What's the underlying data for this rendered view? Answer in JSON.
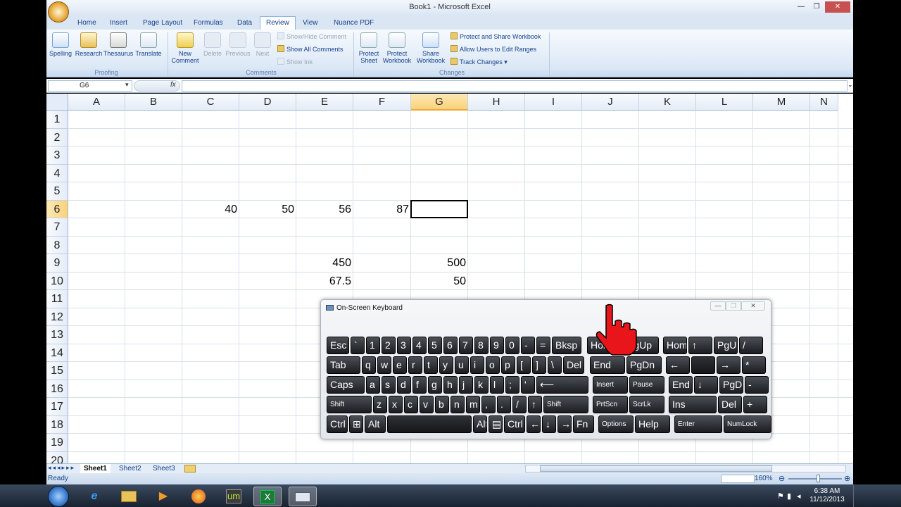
{
  "window": {
    "title": "Book1 - Microsoft Excel",
    "controls": [
      "—",
      "❐",
      "✕"
    ]
  },
  "ribbon": {
    "tabs": [
      "Home",
      "Insert",
      "Page Layout",
      "Formulas",
      "Data",
      "Review",
      "View",
      "Nuance PDF"
    ],
    "active_tab": "Review",
    "proofing": {
      "label": "Proofing",
      "buttons": [
        "Spelling",
        "Research",
        "Thesaurus",
        "Translate"
      ]
    },
    "comments": {
      "label": "Comments",
      "new": "New Comment",
      "delete": "Delete",
      "previous": "Previous",
      "next": "Next",
      "show_hide": "Show/Hide Comment",
      "show_all": "Show All Comments",
      "show_ink": "Show Ink"
    },
    "changes": {
      "label": "Changes",
      "protect_sheet": "Protect Sheet",
      "protect_workbook": "Protect Workbook",
      "share_workbook": "Share Workbook",
      "protect_share": "Protect and Share Workbook",
      "allow_users": "Allow Users to Edit Ranges",
      "track_changes": "Track Changes"
    }
  },
  "formula_bar": {
    "name_box": "G6",
    "fx": "fx",
    "value": ""
  },
  "grid": {
    "columns": [
      "A",
      "B",
      "C",
      "D",
      "E",
      "F",
      "G",
      "H",
      "I",
      "J",
      "K",
      "L",
      "M",
      "N"
    ],
    "selected_column": "G",
    "rows": [
      "1",
      "2",
      "3",
      "4",
      "5",
      "6",
      "7",
      "8",
      "9",
      "10",
      "11",
      "12",
      "13",
      "14",
      "15",
      "16",
      "17",
      "18",
      "19",
      "20"
    ],
    "selected_row": "6",
    "cells": {
      "C6": "40",
      "D6": "50",
      "E6": "56",
      "F6": "87",
      "E9": "450",
      "G9": "500",
      "E10": "67.5",
      "G10": "50"
    }
  },
  "sheets": [
    "Sheet1",
    "Sheet2",
    "Sheet3"
  ],
  "status": {
    "ready": "Ready",
    "zoom": "160%"
  },
  "osk": {
    "title": "On-Screen Keyboard",
    "rows": [
      [
        "Esc",
        "`",
        "1",
        "2",
        "3",
        "4",
        "5",
        "6",
        "7",
        "8",
        "9",
        "0",
        "-",
        "=",
        "Bksp",
        "Home",
        "PgUp",
        "Home",
        "↑",
        "PgUp",
        "/"
      ],
      [
        "Tab",
        "q",
        "w",
        "e",
        "r",
        "t",
        "y",
        "u",
        "i",
        "o",
        "p",
        "[",
        "]",
        "\\",
        "Del",
        "End",
        "PgDn",
        "←",
        "",
        "→",
        "*"
      ],
      [
        "Caps",
        "a",
        "s",
        "d",
        "f",
        "g",
        "h",
        "j",
        "k",
        "l",
        ";",
        "'",
        "⟵",
        "Insert",
        "Pause",
        "End",
        "↓",
        "PgDn",
        "-"
      ],
      [
        "Shift",
        "z",
        "x",
        "c",
        "v",
        "b",
        "n",
        "m",
        ",",
        ".",
        "/",
        "↑",
        "Shift",
        "PrtScn",
        "ScrLk",
        "Ins",
        "Del",
        "+"
      ],
      [
        "Ctrl",
        "⊞",
        "Alt",
        "",
        "Alt",
        "▤",
        "Ctrl",
        "←",
        "↓",
        "→",
        "Fn",
        "Options",
        "Help",
        "Enter",
        "NumLock"
      ]
    ]
  },
  "taskbar": {
    "time": "6:38 AM",
    "date": "11/12/2013"
  }
}
